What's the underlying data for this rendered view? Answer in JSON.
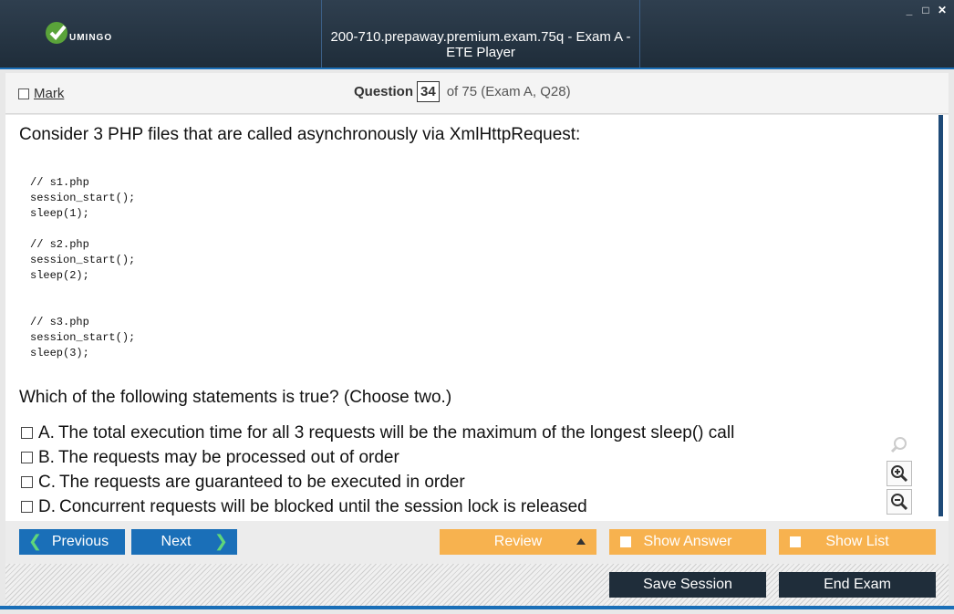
{
  "window": {
    "title": "200-710.prepaway.premium.exam.75q - Exam A - ETE Player",
    "logo_text": "UMINGO",
    "controls": [
      "_",
      "□",
      "✕"
    ]
  },
  "question_bar": {
    "mark_label": "Mark",
    "question_label": "Question",
    "question_number": "34",
    "question_of": "of 75 (Exam A, Q28)"
  },
  "question": {
    "text": "Consider 3 PHP files that are called asynchronously via XmlHttpRequest:",
    "code": "// s1.php\nsession_start();\nsleep(1);\n\n// s2.php\nsession_start();\nsleep(2);\n\n\n// s3.php\nsession_start();\nsleep(3);",
    "prompt": "Which of the following statements is true? (Choose two.)",
    "options": [
      {
        "letter": "A.",
        "text": "The total execution time for all 3 requests will be the maximum of the longest sleep() call"
      },
      {
        "letter": "B.",
        "text": "The requests may be processed out of order"
      },
      {
        "letter": "C.",
        "text": "The requests are guaranteed to be executed in order"
      },
      {
        "letter": "D.",
        "text": "Concurrent requests will be blocked until the session lock is released"
      }
    ]
  },
  "zoom_icons": [
    "search-icon",
    "zoom-in-icon",
    "zoom-out-icon"
  ],
  "nav": {
    "previous_label": "Previous",
    "next_label": "Next",
    "review_label": "Review",
    "show_answer_label": "Show Answer",
    "show_list_label": "Show List"
  },
  "footer": {
    "save_label": "Save Session",
    "end_label": "End Exam"
  },
  "colors": {
    "accent_blue": "#1a6fb8",
    "orange": "#f7b24f",
    "dark": "#1f2d3a",
    "logo_green": "#5aa33a"
  }
}
